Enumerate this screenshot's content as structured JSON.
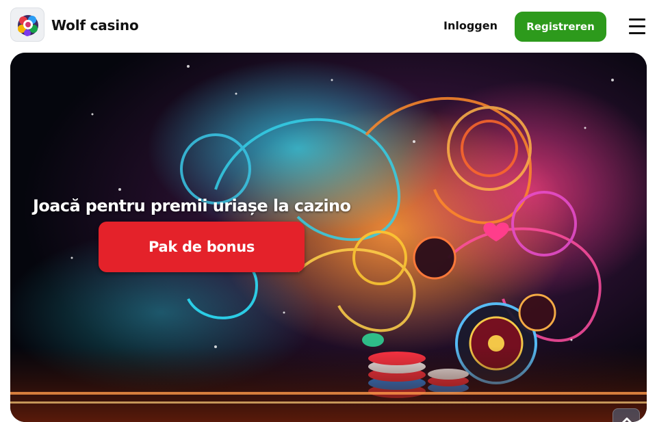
{
  "header": {
    "site_name": "Wolf casino",
    "login_label": "Inloggen",
    "register_label": "Registreren",
    "menu_icon": "hamburger-menu-icon",
    "logo_icon": "casino-chips-logo-icon"
  },
  "hero": {
    "title": "Joacă pentru premii uriașe la cazino",
    "cta_label": "Pak de bonus",
    "background": "neon-casino-roulette-illustration",
    "scroll_icon": "chevron-up-icon"
  },
  "colors": {
    "register_button": "#2d9a1c",
    "cta_button": "#e4222a",
    "text_dark": "#111111",
    "hero_bg": "#05060d"
  }
}
